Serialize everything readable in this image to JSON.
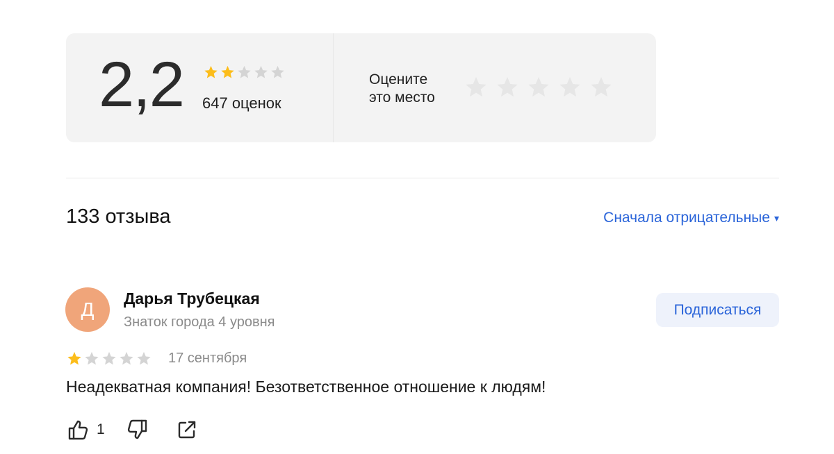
{
  "rating": {
    "value": "2,2",
    "stars_filled": 2,
    "stars_total": 5,
    "count_label": "647 оценок"
  },
  "rate_prompt": {
    "line1": "Оцените",
    "line2": "это место",
    "stars_total": 5
  },
  "reviews": {
    "title": "133 отзыва",
    "sort_label": "Сначала отрицательные",
    "sort_caret": "▾"
  },
  "review": {
    "avatar_letter": "Д",
    "author": "Дарья Трубецкая",
    "level": "Знаток города 4 уровня",
    "subscribe_label": "Подписаться",
    "stars_filled": 1,
    "stars_total": 5,
    "date": "17 сентября",
    "text": "Неадекватная компания! Безответственное отношение к людям!",
    "likes": "1"
  },
  "colors": {
    "star_filled": "#fcbd1b",
    "star_empty": "#d4d4d4",
    "star_empty_large": "#e6e6e6",
    "accent": "#2a64d9",
    "avatar": "#f0a57a"
  },
  "icons": {
    "like": "thumbs-up-icon",
    "dislike": "thumbs-down-icon",
    "share": "share-icon"
  }
}
